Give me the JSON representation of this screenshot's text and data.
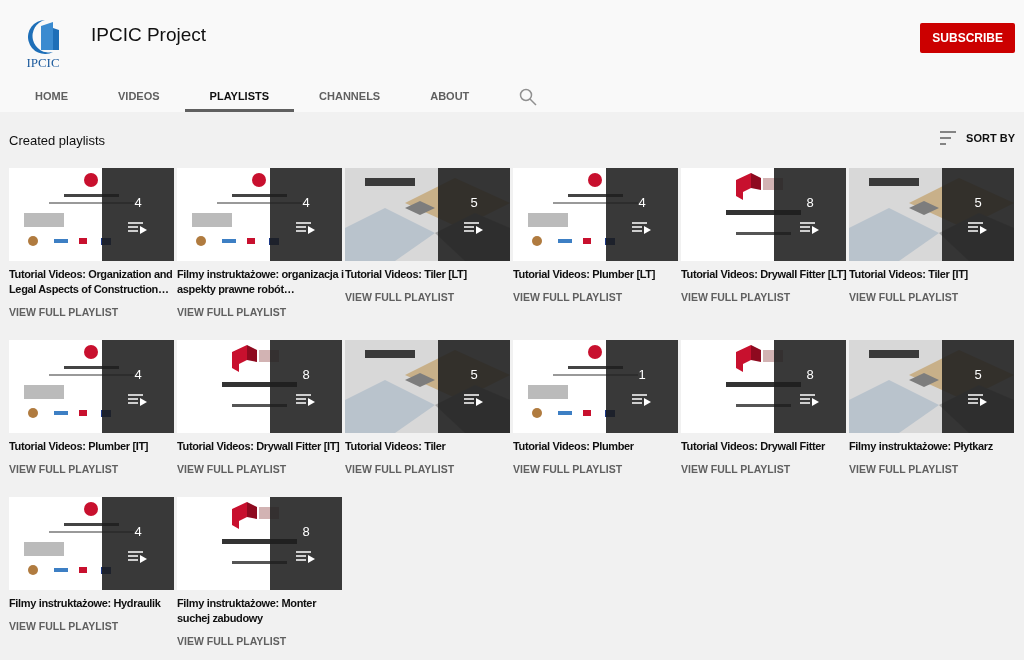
{
  "channel": {
    "logo_text": "IPCIC",
    "name": "IPCIC Project",
    "subscribe": "SUBSCRIBE"
  },
  "tabs": [
    {
      "label": "HOME",
      "selected": false
    },
    {
      "label": "VIDEOS",
      "selected": false
    },
    {
      "label": "PLAYLISTS",
      "selected": true
    },
    {
      "label": "CHANNELS",
      "selected": false
    },
    {
      "label": "ABOUT",
      "selected": false
    }
  ],
  "section": {
    "title": "Created playlists",
    "sort": "SORT BY"
  },
  "playlists": [
    {
      "title": "Tutorial Videos: Organization and Legal Aspects of Construction…",
      "count": "4",
      "link": "VIEW FULL PLAYLIST"
    },
    {
      "title": "Filmy instruktażowe: organizacja i aspekty prawne robót…",
      "count": "4",
      "link": "VIEW FULL PLAYLIST"
    },
    {
      "title": "Tutorial Videos: Tiler [LT]",
      "count": "5",
      "link": "VIEW FULL PLAYLIST"
    },
    {
      "title": "Tutorial Videos: Plumber [LT]",
      "count": "4",
      "link": "VIEW FULL PLAYLIST"
    },
    {
      "title": "Tutorial Videos: Drywall Fitter [LT]",
      "count": "8",
      "link": "VIEW FULL PLAYLIST"
    },
    {
      "title": "Tutorial Videos: Tiler [IT]",
      "count": "5",
      "link": "VIEW FULL PLAYLIST"
    },
    {
      "title": "Tutorial Videos: Plumber [IT]",
      "count": "4",
      "link": "VIEW FULL PLAYLIST"
    },
    {
      "title": "Tutorial Videos: Drywall Fitter [IT]",
      "count": "8",
      "link": "VIEW FULL PLAYLIST"
    },
    {
      "title": "Tutorial Videos: Tiler",
      "count": "5",
      "link": "VIEW FULL PLAYLIST"
    },
    {
      "title": "Tutorial Videos: Plumber",
      "count": "1",
      "link": "VIEW FULL PLAYLIST"
    },
    {
      "title": "Tutorial Videos: Drywall Fitter",
      "count": "8",
      "link": "VIEW FULL PLAYLIST"
    },
    {
      "title": "Filmy instruktażowe: Płytkarz",
      "count": "5",
      "link": "VIEW FULL PLAYLIST"
    },
    {
      "title": "Filmy instruktażowe: Hydraulik",
      "count": "4",
      "link": "VIEW FULL PLAYLIST"
    },
    {
      "title": "Filmy instruktażowe: Monter suchej zabudowy",
      "count": "8",
      "link": "VIEW FULL PLAYLIST"
    }
  ]
}
